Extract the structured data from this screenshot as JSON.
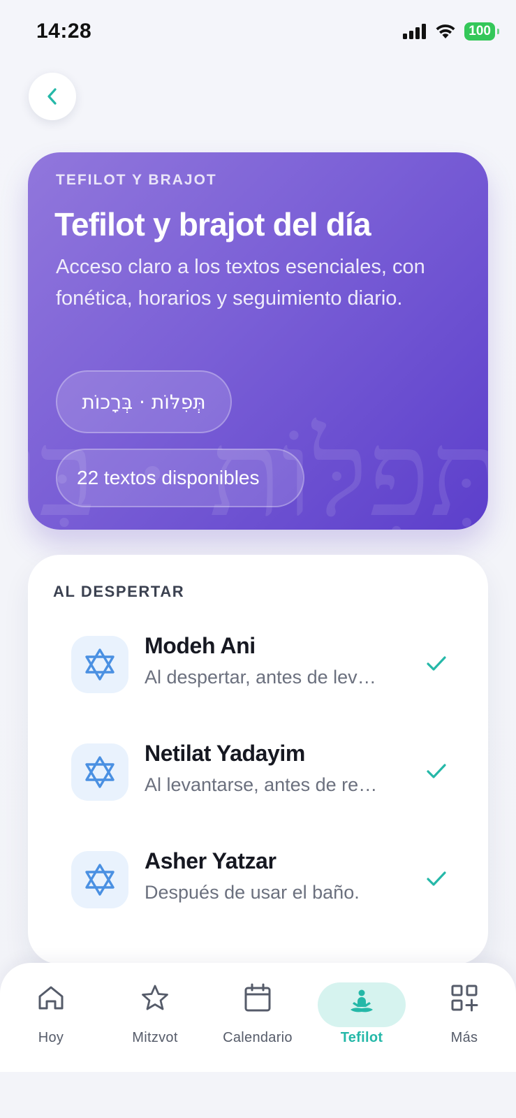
{
  "status_bar": {
    "time": "14:28",
    "battery": "100"
  },
  "hero": {
    "eyebrow": "TEFILOT Y BRAJOT",
    "title": "Tefilot y brajot del día",
    "description": "Acceso claro a los textos esenciales, con fonética, horarios y seguimiento diario.",
    "hebrew_pill": "תְּפִלּוֹת · בְּרָכוֹת",
    "count_pill": "22 textos disponibles"
  },
  "section": {
    "heading": "AL DESPERTAR",
    "items": [
      {
        "title": "Modeh Ani",
        "subtitle": "Al despertar, antes de levantarse.",
        "completed": true
      },
      {
        "title": "Netilat Yadayim",
        "subtitle": "Al levantarse, antes de rezar.",
        "completed": true
      },
      {
        "title": "Asher Yatzar",
        "subtitle": "Después de usar el baño.",
        "completed": true
      }
    ]
  },
  "nav": {
    "items": [
      {
        "label": "Hoy",
        "icon": "home-icon"
      },
      {
        "label": "Mitzvot",
        "icon": "star-icon"
      },
      {
        "label": "Calendario",
        "icon": "calendar-icon"
      },
      {
        "label": "Tefilot",
        "icon": "prayer-icon",
        "active": true
      },
      {
        "label": "Más",
        "icon": "grid-plus-icon"
      }
    ]
  },
  "colors": {
    "accent": "#25b8a8",
    "hero_start": "#9177dc",
    "hero_end": "#5c3fcb",
    "icon_blue": "#4a90e2",
    "icon_bg": "#e9f2fd"
  }
}
